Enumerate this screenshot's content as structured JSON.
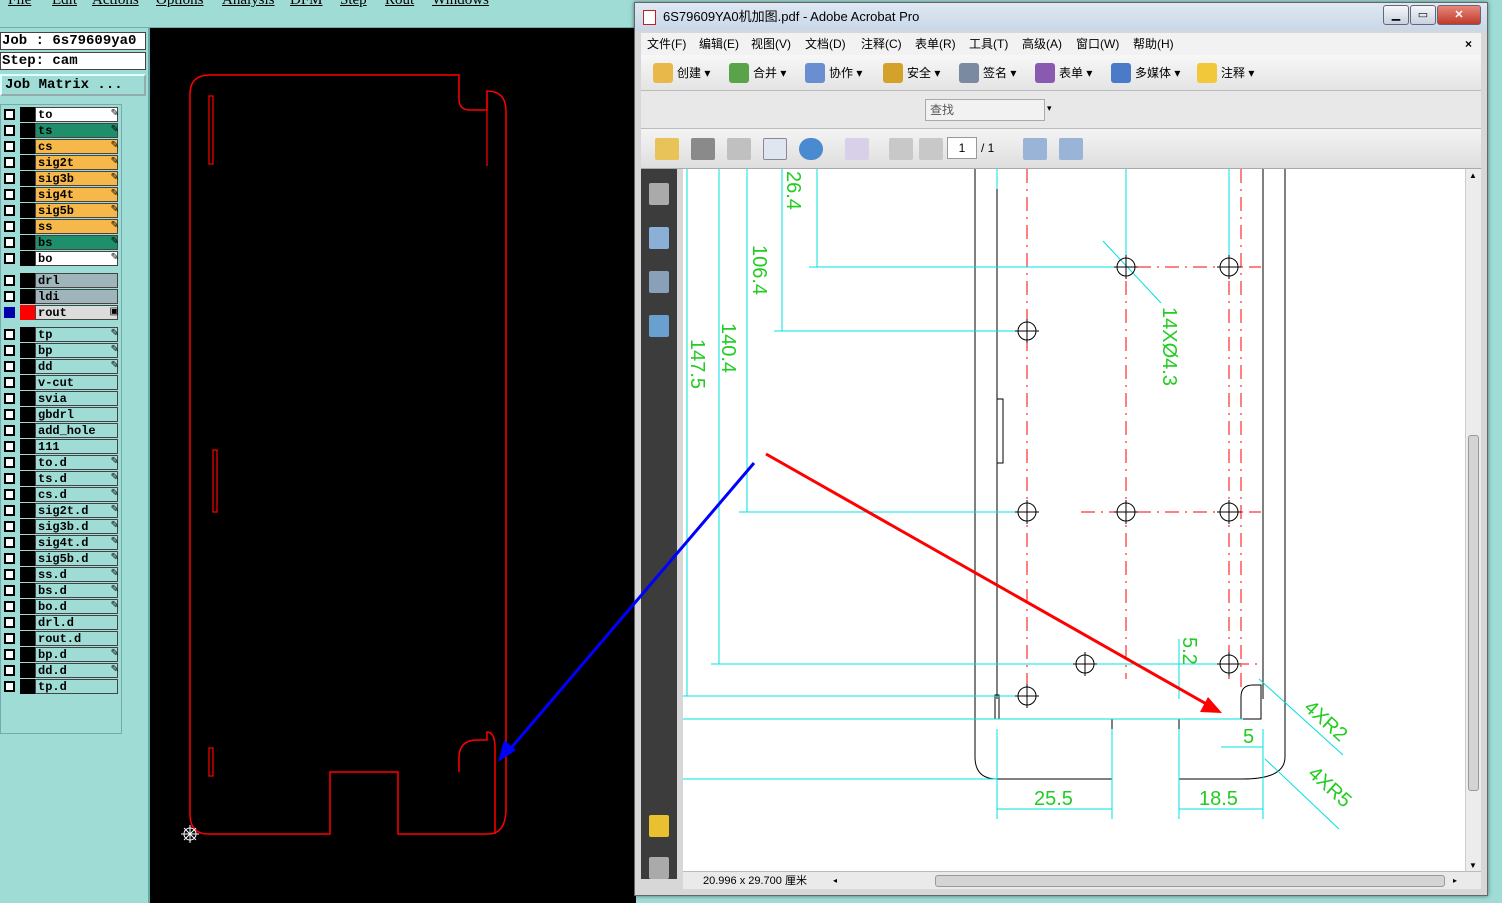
{
  "genesis": {
    "menu": [
      "File",
      "Edit",
      "Actions",
      "Options",
      "Analysis",
      "DFM",
      "Step",
      "Rout",
      "Windows"
    ],
    "job_line": "Job : 6s79609ya0",
    "step_line": "Step: cam",
    "matrix_button": "Job Matrix ...",
    "layers": [
      {
        "name": "to",
        "color": "#ffffff",
        "editable": true
      },
      {
        "name": "ts",
        "color": "#1f8f6b",
        "editable": true
      },
      {
        "name": "cs",
        "color": "#f7b84a",
        "editable": true
      },
      {
        "name": "sig2t",
        "color": "#f7b84a",
        "editable": true
      },
      {
        "name": "sig3b",
        "color": "#f7b84a",
        "editable": true
      },
      {
        "name": "sig4t",
        "color": "#f7b84a",
        "editable": true
      },
      {
        "name": "sig5b",
        "color": "#f7b84a",
        "editable": true
      },
      {
        "name": "ss",
        "color": "#f7b84a",
        "editable": true
      },
      {
        "name": "bs",
        "color": "#1f8f6b",
        "editable": true
      },
      {
        "name": "bo",
        "color": "#ffffff",
        "editable": true
      },
      {
        "name": "drl",
        "color": "#9fb4bb",
        "editable": false
      },
      {
        "name": "ldi",
        "color": "#9fb4bb",
        "editable": false
      },
      {
        "name": "rout",
        "color": "#dcdcdc",
        "editable": true,
        "active": true
      },
      {
        "name": "tp",
        "color": "#9fdcd6",
        "editable": true
      },
      {
        "name": "bp",
        "color": "#9fdcd6",
        "editable": true
      },
      {
        "name": "dd",
        "color": "#9fdcd6",
        "editable": true
      },
      {
        "name": "v-cut",
        "color": "#9fdcd6",
        "editable": false
      },
      {
        "name": "svia",
        "color": "#9fdcd6",
        "editable": false
      },
      {
        "name": "gbdrl",
        "color": "#9fdcd6",
        "editable": false
      },
      {
        "name": "add_hole",
        "color": "#9fdcd6",
        "editable": false
      },
      {
        "name": "111",
        "color": "#9fdcd6",
        "editable": false
      },
      {
        "name": "to.d",
        "color": "#9fdcd6",
        "editable": true
      },
      {
        "name": "ts.d",
        "color": "#9fdcd6",
        "editable": true
      },
      {
        "name": "cs.d",
        "color": "#9fdcd6",
        "editable": true
      },
      {
        "name": "sig2t.d",
        "color": "#9fdcd6",
        "editable": true
      },
      {
        "name": "sig3b.d",
        "color": "#9fdcd6",
        "editable": true
      },
      {
        "name": "sig4t.d",
        "color": "#9fdcd6",
        "editable": true
      },
      {
        "name": "sig5b.d",
        "color": "#9fdcd6",
        "editable": true
      },
      {
        "name": "ss.d",
        "color": "#9fdcd6",
        "editable": true
      },
      {
        "name": "bs.d",
        "color": "#9fdcd6",
        "editable": true
      },
      {
        "name": "bo.d",
        "color": "#9fdcd6",
        "editable": true
      },
      {
        "name": "drl.d",
        "color": "#9fdcd6",
        "editable": false
      },
      {
        "name": "rout.d",
        "color": "#9fdcd6",
        "editable": false
      },
      {
        "name": "bp.d",
        "color": "#9fdcd6",
        "editable": true
      },
      {
        "name": "dd.d",
        "color": "#9fdcd6",
        "editable": true
      },
      {
        "name": "tp.d",
        "color": "#9fdcd6",
        "editable": false
      }
    ]
  },
  "acrobat": {
    "title": "6S79609YA0机加图.pdf - Adobe Acrobat Pro",
    "menu": [
      "文件(F)",
      "编辑(E)",
      "视图(V)",
      "文档(D)",
      "注释(C)",
      "表单(R)",
      "工具(T)",
      "高级(A)",
      "窗口(W)",
      "帮助(H)"
    ],
    "tools": [
      "创建",
      "合并",
      "协作",
      "安全",
      "签名",
      "表单",
      "多媒体",
      "注释"
    ],
    "search_placeholder": "查找",
    "page_current": "1",
    "page_total": "/ 1",
    "status_size": "20.996 x 29.700 厘米",
    "drawing_labels": {
      "d1": "26.4",
      "d2": "106.4",
      "d3": "140.4",
      "d4": "147.5",
      "holes": "14XØ4.3",
      "d5": "5.2",
      "d6": "5",
      "r1": "4XR2",
      "r2": "4XR5",
      "w1": "25.5",
      "w2": "18.5"
    }
  },
  "colors": {
    "dimension": "#00e0e0",
    "dimtext": "#22cc22",
    "rout": "#ff0000",
    "arrow_blue": "#0000ff",
    "arrow_red": "#ff0000"
  }
}
